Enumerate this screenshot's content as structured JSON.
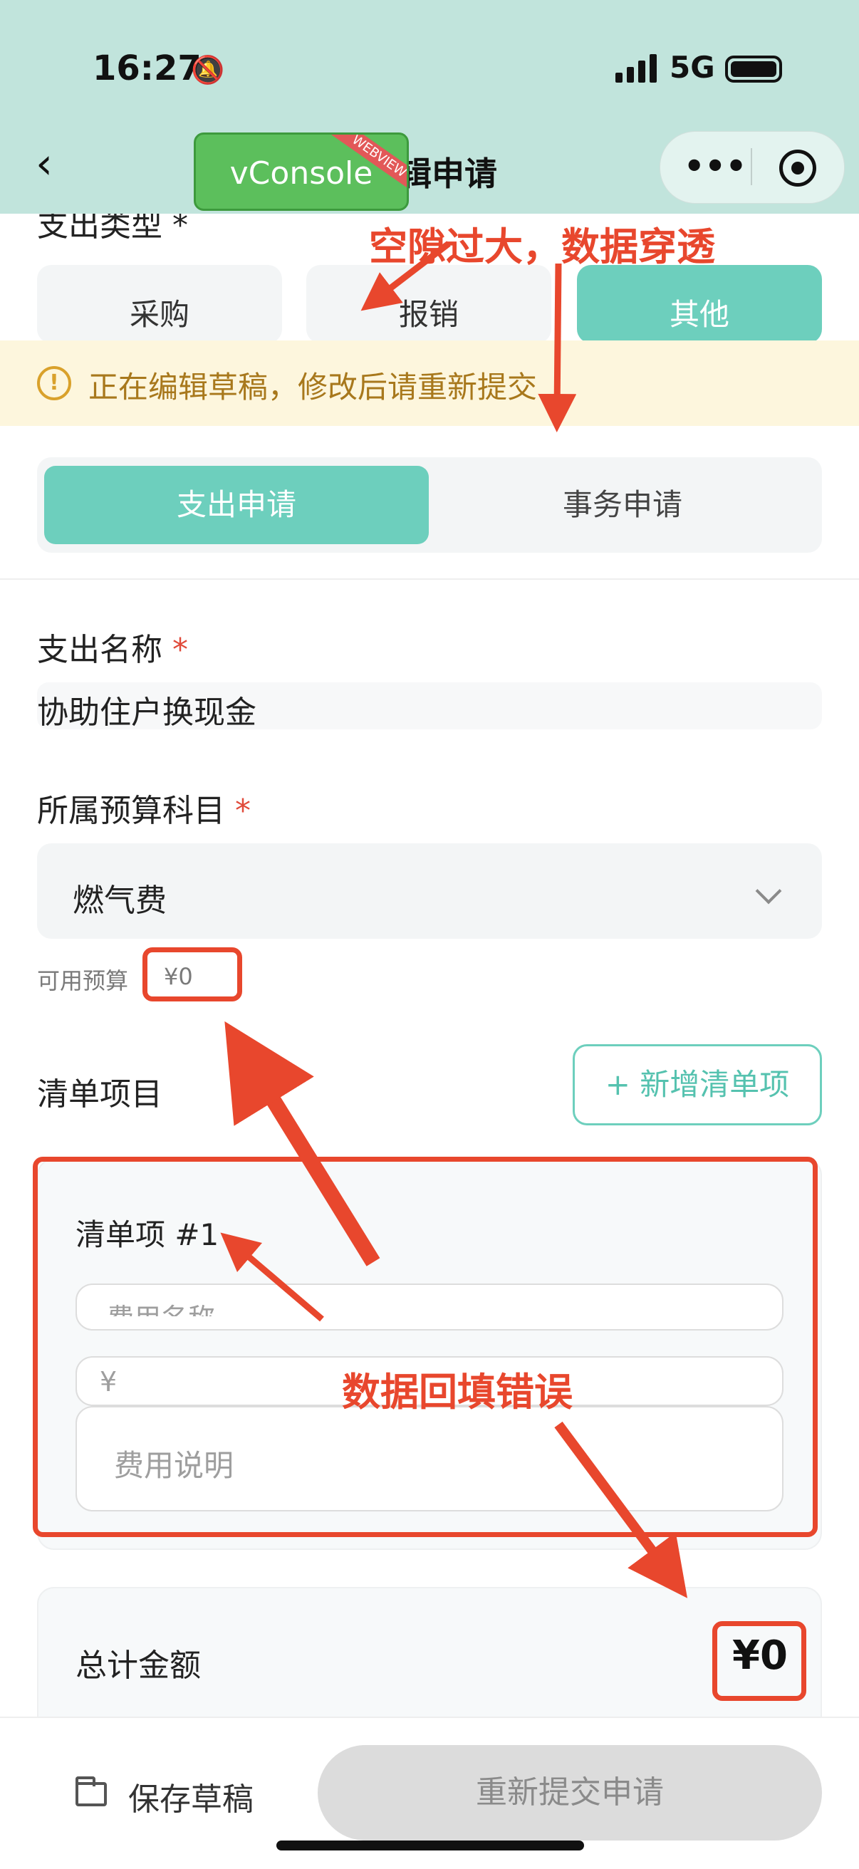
{
  "status_bar": {
    "time": "16:27",
    "network": "5G"
  },
  "nav": {
    "title_partial": "辑申请",
    "vconsole_label": "vConsole",
    "vconsole_ribbon": "WEBVIEW"
  },
  "expense_type": {
    "label_partial": "支出类型 *",
    "options": [
      {
        "label": "采购",
        "active": false
      },
      {
        "label": "报销",
        "active": false
      },
      {
        "label": "其他",
        "active": true
      }
    ]
  },
  "notice": {
    "text": "正在编辑草稿，修改后请重新提交"
  },
  "apply_type": {
    "options": [
      {
        "label": "支出申请",
        "active": true
      },
      {
        "label": "事务申请",
        "active": false
      }
    ]
  },
  "expense_name": {
    "label": "支出名称",
    "required_mark": "*",
    "value": "协助住户换现金"
  },
  "budget": {
    "label": "所属预算科目",
    "required_mark": "*",
    "selected": "燃气费",
    "available_label": "可用预算",
    "available_value": "¥0"
  },
  "list": {
    "title": "清单项目",
    "add_button": "+ 新增清单项",
    "items": [
      {
        "title": "清单项 #1",
        "name_placeholder": "费用名称",
        "amount_placeholder": "¥",
        "desc_placeholder": "费用说明"
      }
    ]
  },
  "total": {
    "label": "总计金额",
    "value": "¥0"
  },
  "footer": {
    "save_draft": "保存草稿",
    "resubmit": "重新提交申请"
  },
  "annotations": {
    "gap_note": "空隙过大，数据穿透",
    "data_note": "数据回填错误"
  },
  "colors": {
    "accent": "#6dcfbd",
    "annotation": "#e8472d",
    "header_bg": "#c1e4dc",
    "notice_bg": "#fdf6dd"
  }
}
